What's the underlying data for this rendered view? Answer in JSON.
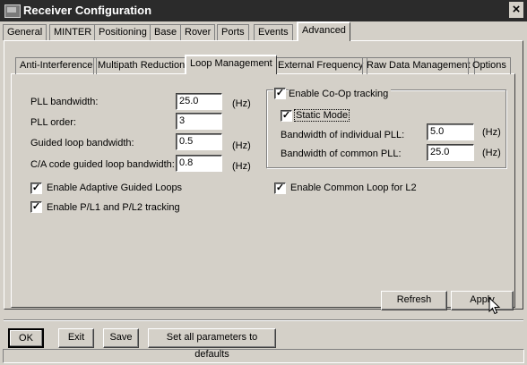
{
  "window": {
    "title": "Receiver Configuration",
    "close_glyph": "×"
  },
  "main_tabs": [
    "General",
    "MINTER",
    "Positioning",
    "Base",
    "Rover",
    "Ports",
    "Events",
    "Advanced"
  ],
  "active_main_tab": "Advanced",
  "sub_tabs": [
    "Anti-Interference",
    "Multipath Reduction",
    "Loop Management",
    "External Frequency",
    "Raw Data Management",
    "Options"
  ],
  "active_sub_tab": "Loop Management",
  "fields": {
    "pll_bandwidth": {
      "label": "PLL bandwidth:",
      "value": "25.0",
      "unit": "(Hz)"
    },
    "pll_order": {
      "label": "PLL order:",
      "value": "3"
    },
    "guided_loop_bandwidth": {
      "label": "Guided loop bandwidth:",
      "value": "0.5",
      "unit": "(Hz)"
    },
    "ca_code_guided": {
      "label": "C/A code guided loop bandwidth:",
      "value": "0.8",
      "unit": "(Hz)"
    }
  },
  "checkboxes": {
    "adaptive_guided": {
      "label": "Enable Adaptive Guided Loops",
      "checked": true
    },
    "pl1_pl2": {
      "label": "Enable P/L1 and P/L2 tracking",
      "checked": true
    },
    "common_loop_l2": {
      "label": "Enable Common Loop for L2",
      "checked": true
    }
  },
  "coop": {
    "enable_label": "Enable Co-Op tracking",
    "enable_checked": true,
    "static_label": "Static Mode",
    "static_checked": true,
    "individual": {
      "label": "Bandwidth of individual PLL:",
      "value": "5.0",
      "unit": "(Hz)"
    },
    "common": {
      "label": "Bandwidth of common PLL:",
      "value": "25.0",
      "unit": "(Hz)"
    }
  },
  "panel_buttons": {
    "refresh": "Refresh",
    "apply": "Apply"
  },
  "bottom_buttons": {
    "ok": "OK",
    "exit": "Exit",
    "save": "Save",
    "defaults": "Set all parameters to defaults"
  },
  "check_glyph": "✓"
}
